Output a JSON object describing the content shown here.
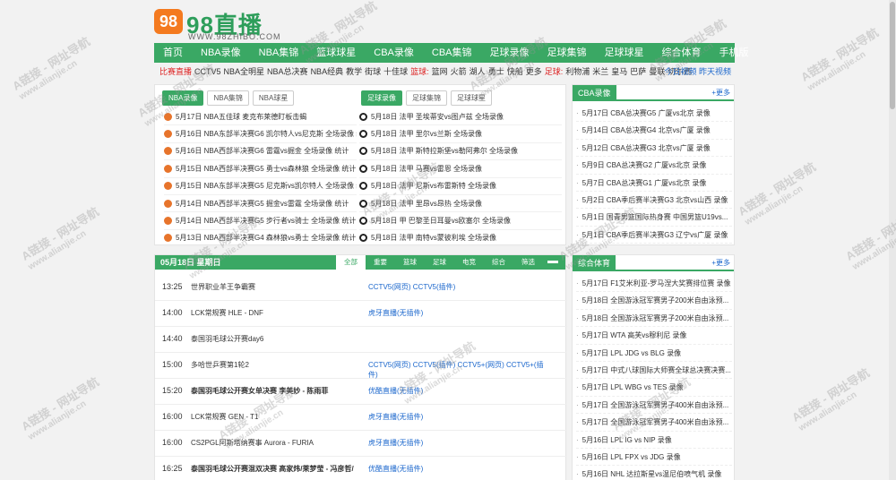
{
  "logo": {
    "badge": "98",
    "text": "98直播",
    "url": "WWW.98ZHIBO.COM"
  },
  "nav": [
    "首页",
    "NBA录像",
    "NBA集锦",
    "篮球球星",
    "CBA录像",
    "CBA集锦",
    "足球录像",
    "足球集锦",
    "足球球星",
    "综合体育",
    "手机版"
  ],
  "subnav": {
    "items": [
      {
        "t": "比赛直播",
        "c": "red"
      },
      {
        "t": "CCTV5"
      },
      {
        "t": "NBA全明星"
      },
      {
        "t": "NBA总决赛"
      },
      {
        "t": "NBA经典"
      },
      {
        "t": "教学"
      },
      {
        "t": "街球"
      },
      {
        "t": "十佳球"
      },
      {
        "t": "篮球:",
        "c": "red"
      },
      {
        "t": "篮网"
      },
      {
        "t": "火箭"
      },
      {
        "t": "湖人"
      },
      {
        "t": "勇士"
      },
      {
        "t": "快船"
      },
      {
        "t": "更多"
      },
      {
        "t": "足球:",
        "c": "red"
      },
      {
        "t": "利物浦"
      },
      {
        "t": "米兰"
      },
      {
        "t": "皇马"
      },
      {
        "t": "巴萨"
      },
      {
        "t": "曼联"
      },
      {
        "t": "切尔西"
      }
    ],
    "right": "今日视频  昨天视频"
  },
  "nba": {
    "left_tabs": [
      "NBA录像",
      "NBA集锦",
      "NBA球星"
    ],
    "right_tabs": [
      "足球录像",
      "足球集锦",
      "足球球星"
    ],
    "left": [
      "5月17日 NBA五佳球 麦克布莱德盯板击蝎",
      "5月16日 NBA东部半决赛G6 凯尔特人vs尼克斯 全场录像 统计",
      "5月16日 NBA西部半决赛G6 雷霆vs掘金 全场录像 统计",
      "5月15日 NBA西部半决赛G5 勇士vs森林狼 全场录像 统计",
      "5月15日 NBA东部半决赛G5 尼克斯vs凯尔特人 全场录像 统计",
      "5月14日 NBA西部半决赛G5 掘金vs雷霆 全场录像 统计",
      "5月14日 NBA西部半决赛G5 步行者vs骑士 全场录像 统计",
      "5月13日 NBA西部半决赛G4 森林狼vs勇士 全场录像 统计"
    ],
    "right": [
      "5月18日 法甲 圣埃蒂安vs图卢兹 全场录像",
      "5月18日 法甲 里尔vs兰斯 全场录像",
      "5月18日 法甲 斯特拉斯堡vs勒阿弗尔 全场录像",
      "5月18日 法甲 马赛vs雷恩 全场录像",
      "5月18日 法甲 尼斯vs布雷斯特 全场录像",
      "5月18日 法甲 里昂vs昂热 全场录像",
      "5月18日 甲 巴黎圣日耳曼vs欧塞尔 全场录像",
      "5月18日 法甲 南特vs蒙彼利埃 全场录像"
    ]
  },
  "cba": {
    "title": "CBA录像",
    "more": "+更多",
    "items": [
      "5月17日 CBA总决赛G5 广厦vs北京 录像",
      "5月14日 CBA总决赛G4 北京vs广厦 录像",
      "5月12日 CBA总决赛G3 北京vs广厦 录像",
      "5月9日 CBA总决赛G2 广厦vs北京 录像",
      "5月7日 CBA总决赛G1 广厦vs北京 录像",
      "5月2日 CBA季后赛半决赛G3 北京vs山西 录像",
      "5月1日 国青男篮国际热身赛 中国男篮U19vs...",
      "5月1日 CBA季后赛半决赛G3 辽宁vs广厦 录像"
    ]
  },
  "zh": {
    "title": "综合体育",
    "more": "+更多",
    "items": [
      "5月17日 F1艾米利亚-罗马涅大奖赛排位赛 录像",
      "5月18日 全国游泳冠军赛男子200米自由泳预...",
      "5月18日 全国游泳冠军赛男子200米自由泳预...",
      "5月17日 WTA 高芙vs穆利尼 录像",
      "5月17日 LPL JDG vs BLG 录像",
      "5月17日 中式八球国际大师赛全球总决赛决赛...",
      "5月17日 LPL WBG vs TES 录像",
      "5月17日 全国游泳冠军赛男子400米自由泳预...",
      "5月17日 全国游泳冠军赛男子400米自由泳预...",
      "5月16日 LPL IG vs NIP 录像",
      "5月16日 LPL FPX vs JDG 录像",
      "5月16日 NHL 达拉斯星vs温尼伯喷气机 录像"
    ]
  },
  "schedule": {
    "date": "05月18日 星期日",
    "tabs": [
      "全部",
      "重要",
      "篮球",
      "足球",
      "电竞",
      "综合",
      "筛选"
    ],
    "rows": [
      {
        "time": "13:25",
        "name": "世界职业羊王争霸赛",
        "bold": false,
        "ch": "CCTV5(网页)  CCTV5(插件)"
      },
      {
        "time": "14:00",
        "name": "LCK常规赛   HLE - DNF",
        "bold": false,
        "ch": "虎牙直播(无插件)"
      },
      {
        "time": "14:40",
        "name": "泰国羽毛球公开赛day6",
        "bold": false,
        "ch": ""
      },
      {
        "time": "15:00",
        "name": "多哈世乒赛第1轮2",
        "bold": false,
        "ch": "CCTV5(网页)  CCTV5(插件)  CCTV5+(网页)  CCTV5+(插件)"
      },
      {
        "time": "15:20",
        "name": "泰国羽毛球公开赛女单决赛   李美妙 - 陈雨菲",
        "bold": true,
        "ch": "优酷直播(无插件)"
      },
      {
        "time": "16:00",
        "name": "LCK常规赛   GEN - T1",
        "bold": false,
        "ch": "虎牙直播(无插件)"
      },
      {
        "time": "16:00",
        "name": "CS2PGL阿斯塔纳赛事   Aurora - FURIA",
        "bold": false,
        "ch": "虎牙直播(无插件)"
      },
      {
        "time": "16:25",
        "name": "泰国羽毛球公开赛混双决赛   高家炜/莱梦莹 - 冯彦哲/",
        "bold": true,
        "ch": "优酷直播(无插件)"
      }
    ]
  },
  "watermark": {
    "text": "A链接 - 网址导航",
    "url": "www.alianjie.cn"
  }
}
